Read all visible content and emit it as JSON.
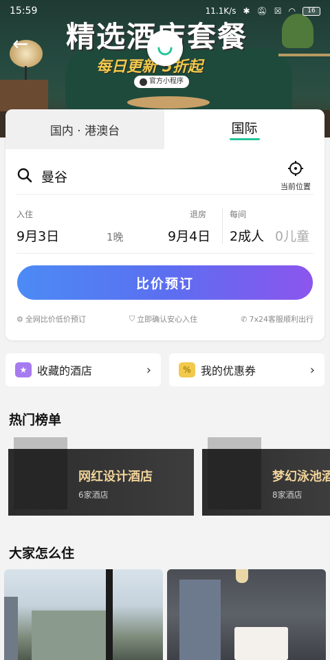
{
  "status_bar": {
    "time": "15:59",
    "network_speed": "11.1K/s",
    "battery": "16"
  },
  "banner": {
    "title": "精选酒店套餐",
    "subtitle": "每日更新 5折起",
    "pill": "官方小程序"
  },
  "search_card": {
    "tabs": [
      {
        "label": "国内 · 港澳台",
        "active": false
      },
      {
        "label": "国际",
        "active": true
      }
    ],
    "destination": "曼谷",
    "current_location_label": "当前位置",
    "check_in_label": "入住",
    "check_in_date": "9月3日",
    "nights": "1晚",
    "check_out_label": "退房",
    "check_out_date": "9月4日",
    "per_room_label": "每间",
    "adults": "2成人",
    "children": "0儿童",
    "cta_label": "比价预订",
    "features": [
      "全网比价低价预订",
      "立即确认安心入住",
      "7x24客服顺利出行"
    ]
  },
  "quick_links": [
    {
      "label": "收藏的酒店",
      "icon": "star-folder-icon",
      "color": "#a77bf0"
    },
    {
      "label": "我的优惠券",
      "icon": "coupon-icon",
      "color": "#f2c94c"
    }
  ],
  "hot_lists": {
    "title": "热门榜单",
    "items": [
      {
        "name": "网红设计酒店",
        "count": "6家酒店"
      },
      {
        "name": "梦幻泳池酒店",
        "count": "8家酒店"
      }
    ]
  },
  "how_people_stay": {
    "title": "大家怎么住"
  },
  "colors": {
    "accent_green": "#25c59a",
    "cta_start": "#4c8bf5",
    "cta_end": "#8c55ee",
    "gold_text": "#f1d39a"
  }
}
